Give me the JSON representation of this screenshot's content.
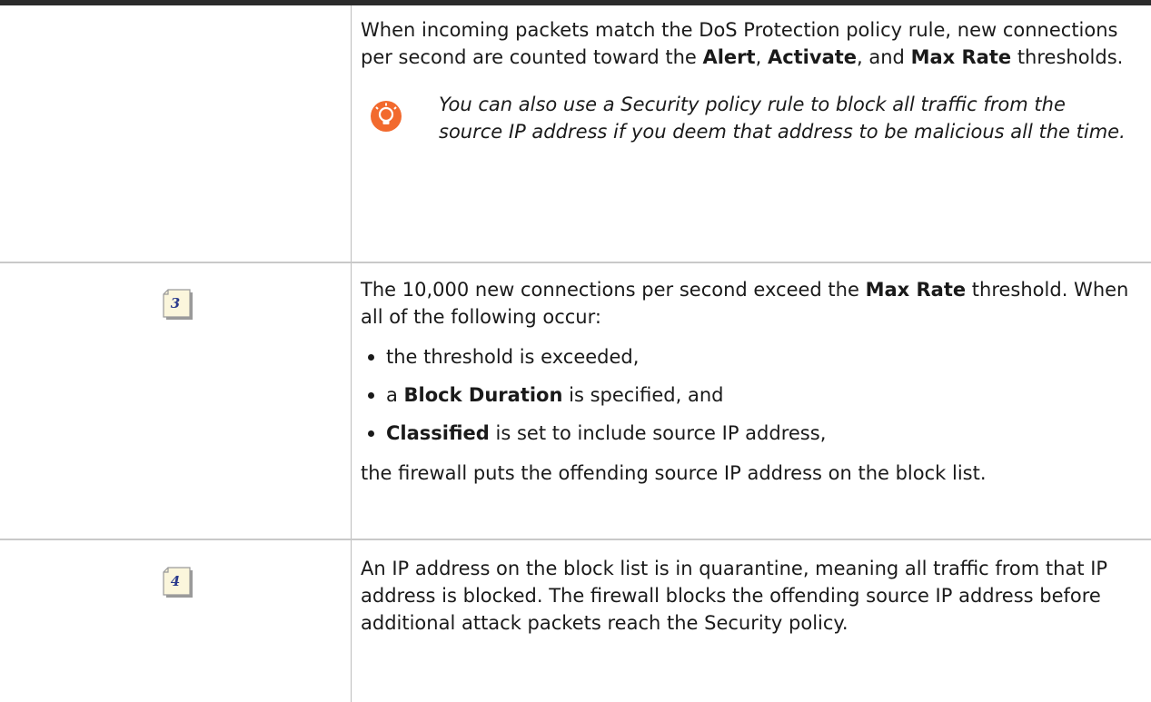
{
  "colors": {
    "tip_icon": "#f26a2e",
    "step_icon_fill": "#fbf6dc",
    "step_number": "#2a3a8c"
  },
  "row1": {
    "seg1": "When incoming packets match the DoS Protection policy rule, new connections per second are counted toward the ",
    "alert": "Alert",
    "seg2": ", ",
    "activate": "Activate",
    "seg3": ", and ",
    "max_rate": "Max Rate",
    "seg4": " thresholds.",
    "tip_icon": "lightbulb-icon",
    "tip_text": "You can also use a Security policy rule to block all traffic from the source IP address if you deem that address to be malicious all the time."
  },
  "row2": {
    "step": "3",
    "step_icon": "note-page-icon",
    "seg1": "The 10,000 new connections per second exceed the ",
    "max_rate": "Max Rate",
    "seg2": " threshold. When all of the following occur:",
    "bullet1": "the threshold is exceeded,",
    "bullet2_a": "a ",
    "bullet2_bold": "Block Duration",
    "bullet2_b": " is specified, and",
    "bullet3_bold": "Classified",
    "bullet3_b": " is set to include source IP address,",
    "closing": "the firewall puts the offending source IP address on the block list."
  },
  "row3": {
    "step": "4",
    "step_icon": "note-page-icon",
    "text": "An IP address on the block list is in quarantine, meaning all traffic from that IP address is blocked. The firewall blocks the offending source IP address before additional attack packets reach the Security policy."
  }
}
